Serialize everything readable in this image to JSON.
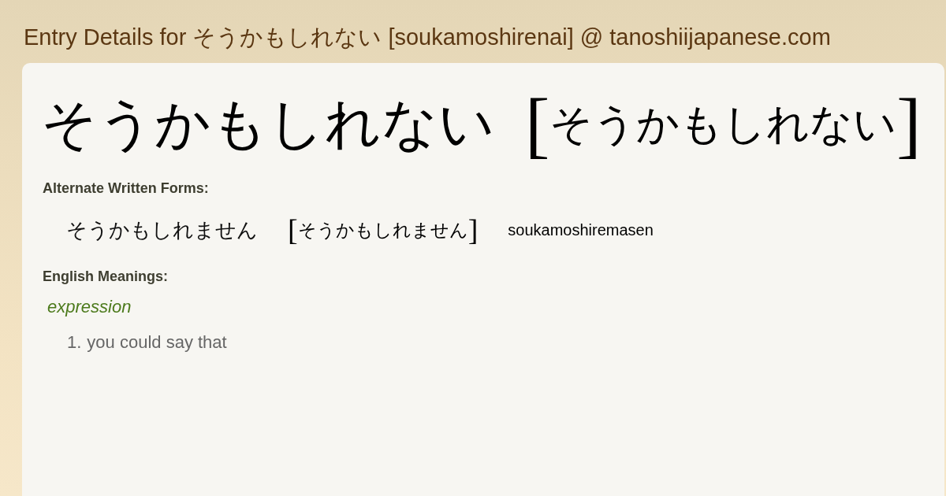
{
  "page_title": "Entry Details for そうかもしれない [soukamoshirenai] @ tanoshiijapanese.com",
  "entry": {
    "word": "そうかもしれない",
    "reading_open": "[",
    "reading": "そうかもしれない",
    "reading_close": "]"
  },
  "alternate_forms": {
    "heading": "Alternate Written Forms:",
    "items": [
      {
        "written": "そうかもしれません",
        "reading_open": "[",
        "reading": "そうかもしれません",
        "reading_close": "]",
        "romaji": "soukamoshiremasen"
      }
    ]
  },
  "meanings": {
    "heading": "English Meanings:",
    "groups": [
      {
        "part_of_speech": "expression",
        "senses": [
          {
            "number": "1.",
            "text": "you could say that"
          }
        ]
      }
    ]
  }
}
